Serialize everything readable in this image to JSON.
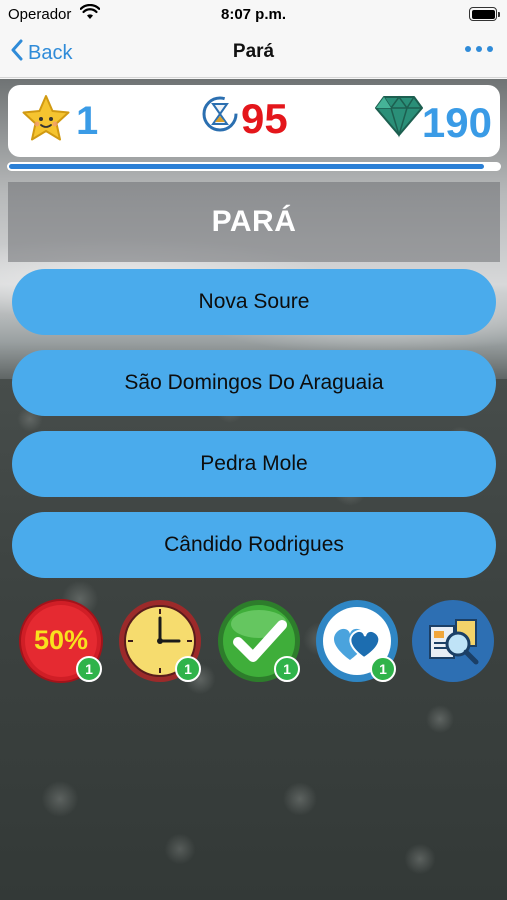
{
  "status_bar": {
    "carrier": "Operador",
    "time": "8:07 p.m."
  },
  "nav": {
    "back_label": "Back",
    "title": "Pará"
  },
  "scores": {
    "stars": "1",
    "timer": "95",
    "gems": "190"
  },
  "progress": {
    "fraction": 0.97
  },
  "question": {
    "text": "PARÁ"
  },
  "answers": [
    {
      "label": "Nova Soure"
    },
    {
      "label": "São Domingos Do Araguaia"
    },
    {
      "label": "Pedra Mole"
    },
    {
      "label": "Cândido Rodrigues"
    }
  ],
  "powerups": [
    {
      "icon": "fifty-fifty-icon",
      "label": "50%",
      "count": "1"
    },
    {
      "icon": "clock-icon",
      "count": "1"
    },
    {
      "icon": "checkmark-icon",
      "count": "1"
    },
    {
      "icon": "hearts-icon",
      "count": "1"
    },
    {
      "icon": "magnifier-document-icon"
    }
  ],
  "colors": {
    "accent_blue": "#3a9be6",
    "answer_button": "#4aabec",
    "timer_red": "#e4161b",
    "badge_green": "#2fb34a"
  }
}
